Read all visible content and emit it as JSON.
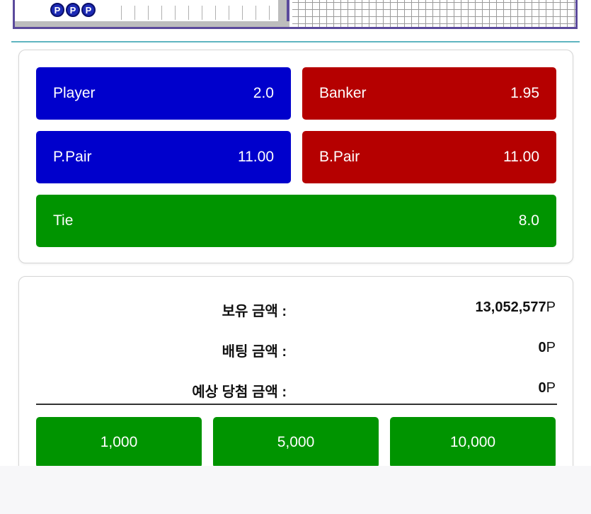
{
  "scoreboard": {
    "chips": [
      "P",
      "P",
      "P"
    ]
  },
  "bets": [
    {
      "label": "Player",
      "odds": "2.0"
    },
    {
      "label": "Banker",
      "odds": "1.95"
    },
    {
      "label": "P.Pair",
      "odds": "11.00"
    },
    {
      "label": "B.Pair",
      "odds": "11.00"
    },
    {
      "label": "Tie",
      "odds": "8.0"
    }
  ],
  "info": {
    "balance_label": "보유 금액 :",
    "balance_value": "13,052,577",
    "bet_label": "배팅 금액 :",
    "bet_value": "0",
    "expected_label": "예상 당첨 금액 :",
    "expected_value": "0",
    "unit": "P"
  },
  "amounts": [
    "1,000",
    "5,000",
    "10,000"
  ],
  "colors": {
    "player": "#0000cc",
    "banker": "#b50000",
    "tie": "#009400",
    "scoreboard_border": "#5b4a9c",
    "separator": "#5fb5c0"
  }
}
